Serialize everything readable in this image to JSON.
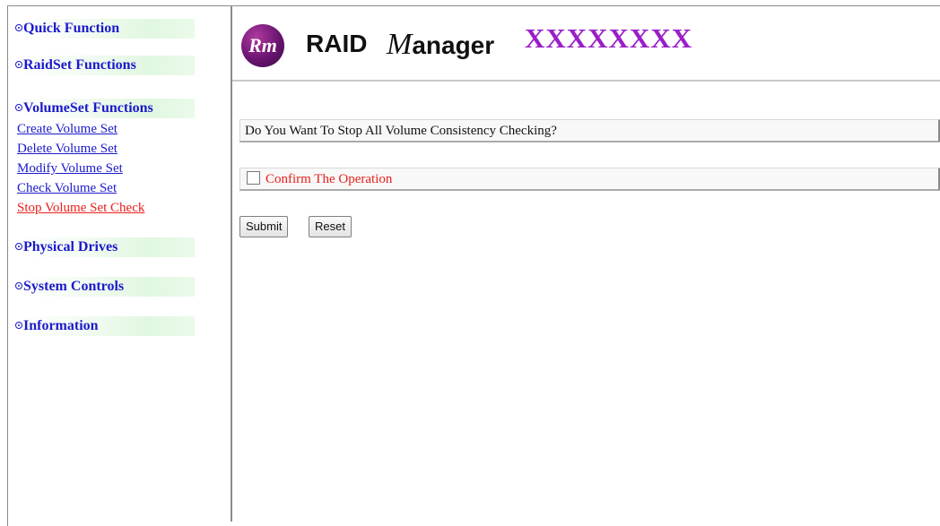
{
  "nav": {
    "quick_function": "Quick Function",
    "raidset_functions": "RaidSet Functions",
    "volumeset_functions": "VolumeSet Functions",
    "volumeset_items": [
      "Create Volume Set",
      "Delete Volume Set",
      "Modify Volume Set",
      "Check Volume Set",
      "Stop Volume Set Check"
    ],
    "active_item": "Stop Volume Set Check",
    "physical_drives": "Physical Drives",
    "system_controls": "System Controls",
    "information": "Information"
  },
  "header": {
    "logo_mark": "Rm",
    "logo_raid": "RAID",
    "logo_manager_initial": "M",
    "logo_manager_rest": "anager",
    "model": "XXXXXXXX"
  },
  "main": {
    "question": "Do You Want To Stop All Volume Consistency Checking?",
    "confirm_label": "Confirm The Operation",
    "confirm_checked": false,
    "submit_label": "Submit",
    "reset_label": "Reset"
  },
  "colors": {
    "link": "#1a1acc",
    "active_link": "#e8201c",
    "model_text": "#9a1ec8",
    "logo_purple": "#6a1470"
  }
}
